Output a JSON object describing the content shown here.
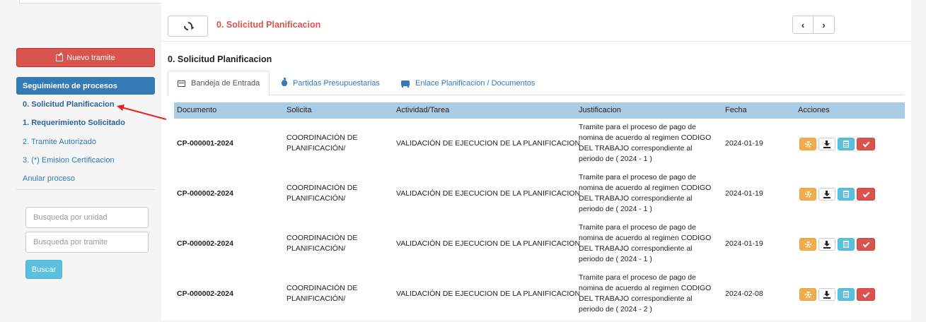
{
  "sidebar": {
    "new_button": "Nuevo tramite",
    "section_title": "Seguimiento de procesos",
    "items": [
      {
        "label": "0. Solicitud Planificacion"
      },
      {
        "label": "1. Requerimiento Solicitado"
      },
      {
        "label": "2. Tramite Autorizado"
      },
      {
        "label": "3. (*) Emision Certificacion"
      },
      {
        "label": "Anular proceso"
      }
    ],
    "search_unit_placeholder": "Busqueda por unidad",
    "search_tramite_placeholder": "Busqueda por tramite",
    "search_button": "Buscar"
  },
  "header": {
    "title": "0. Solicitud Planificacion",
    "prev_icon": "chevron-left-icon",
    "next_icon": "chevron-right-icon"
  },
  "main": {
    "heading": "0. Solicitud Planificacion",
    "tabs": [
      {
        "label": "Bandeja de Entrada",
        "icon": "inbox-icon",
        "active": true
      },
      {
        "label": "Partidas Presupuestarias",
        "icon": "apple-icon",
        "active": false
      },
      {
        "label": "Enlace Planificacion / Documentos",
        "icon": "bus-icon",
        "active": false
      }
    ],
    "table": {
      "headers": [
        "Documento",
        "Solicita",
        "Actividad/Tarea",
        "Justificacion",
        "Fecha",
        "Acciones"
      ],
      "rows": [
        {
          "documento": "CP-000001-2024",
          "solicita_1": "COORDINACIÓN DE",
          "solicita_2": "PLANIFICACIÓN/",
          "actividad": "VALIDACIÓN DE EJECUCION DE LA PLANIFICACION",
          "just_1": "Tramite para el proceso de pago de",
          "just_2": "nomina de acuerdo al regimen CODIGO",
          "just_3": "DEL TRABAJO correspondiente al",
          "just_4": "periodo de ( 2024 - 1 )",
          "fecha": "2024-01-19"
        },
        {
          "documento": "CP-000002-2024",
          "solicita_1": "COORDINACIÓN DE",
          "solicita_2": "PLANIFICACIÓN/",
          "actividad": "VALIDACIÓN DE EJECUCION DE LA PLANIFICACION",
          "just_1": "Tramite para el proceso de pago de",
          "just_2": "nomina de acuerdo al regimen CODIGO",
          "just_3": "DEL TRABAJO correspondiente al",
          "just_4": "periodo de ( 2024 - 1 )",
          "fecha": "2024-01-19"
        },
        {
          "documento": "CP-000002-2024",
          "solicita_1": "COORDINACIÓN DE",
          "solicita_2": "PLANIFICACIÓN/",
          "actividad": "VALIDACIÓN DE EJECUCION DE LA PLANIFICACION",
          "just_1": "Tramite para el proceso de pago de",
          "just_2": "nomina de acuerdo al regimen CODIGO",
          "just_3": "DEL TRABAJO correspondiente al",
          "just_4": "periodo de ( 2024 - 1 )",
          "fecha": "2024-01-19"
        },
        {
          "documento": "CP-000002-2024",
          "solicita_1": "COORDINACIÓN DE",
          "solicita_2": "PLANIFICACIÓN/",
          "actividad": "VALIDACIÓN DE EJECUCION DE LA PLANIFICACION",
          "just_1": "Tramite para el proceso de pago de",
          "just_2": "nomina de acuerdo al regimen CODIGO",
          "just_3": "DEL TRABAJO correspondiente al",
          "just_4": "periodo de ( 2024 - 2 )",
          "fecha": "2024-02-08"
        }
      ]
    }
  },
  "colors": {
    "danger": "#d9534f",
    "primary": "#337ab7",
    "info": "#5bc0de",
    "warning": "#f0ad4e",
    "table_header": "#aacce6"
  }
}
